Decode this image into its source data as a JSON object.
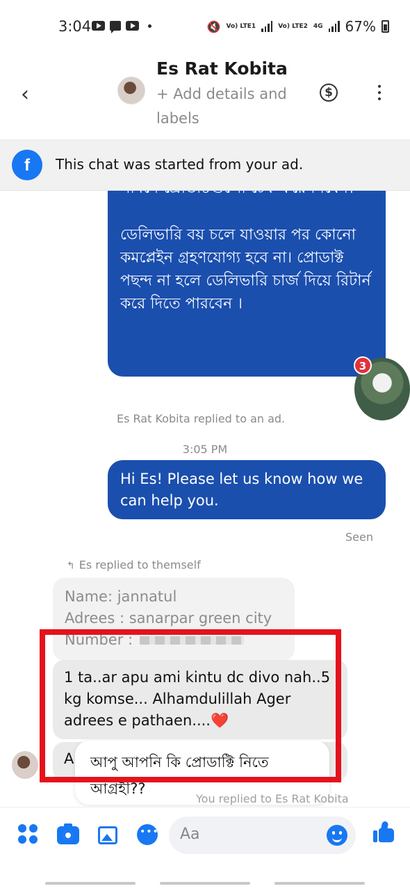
{
  "status_bar": {
    "time": "3:04",
    "network_1": "Vo) LTE1",
    "network_2": "Vo) LTE2",
    "network_type": "4G",
    "battery": "67%"
  },
  "header": {
    "contact_name": "Es Rat Kobita",
    "subtitle": "+ Add details and labels"
  },
  "banner": {
    "text": "This chat was started from your ad."
  },
  "messages": {
    "outgoing_long": {
      "line_top": "সামনে প্রোডাক্টগুলো চেক করে নিবেন।",
      "paragraph": "ডেলিভারি বয় চলে যাওয়ার পর কোনো কমপ্লেইন গ্রহণযোগ্য হবে না। প্রোডাক্ট পছন্দ না হলে ডেলিভারি চার্জ দিয়ে রিটার্ন করে দিতে পারবেন ।"
    },
    "seen_badge_count": "3",
    "reply_meta": "Es Rat Kobita replied to an ad.",
    "timestamp": "3:05 PM",
    "outgoing_greeting": "Hi Es! Please let us know how we can help you.",
    "seen_label": "Seen",
    "reply_self_label": "Es replied to themself",
    "quoted": {
      "line1": "Name: jannatul",
      "line2": "Adrees : sanarpar green city",
      "line3": "Number :"
    },
    "incoming_main": "1 ta..ar apu ami kintu dc divo nah..5 kg komse... Alhamdulillah Ager adrees e pathaen....",
    "incoming_short_prefix": "A",
    "overlay_reply": "আপু আপনি কি প্রোডাক্টি নিতে আগ্রহী??",
    "you_replied": "You replied to Es Rat Kobita"
  },
  "composer": {
    "placeholder": "Aa"
  },
  "colors": {
    "accent": "#1877f2",
    "outgoing_bubble": "#1b4fae",
    "annotation_box": "#e5121c"
  }
}
